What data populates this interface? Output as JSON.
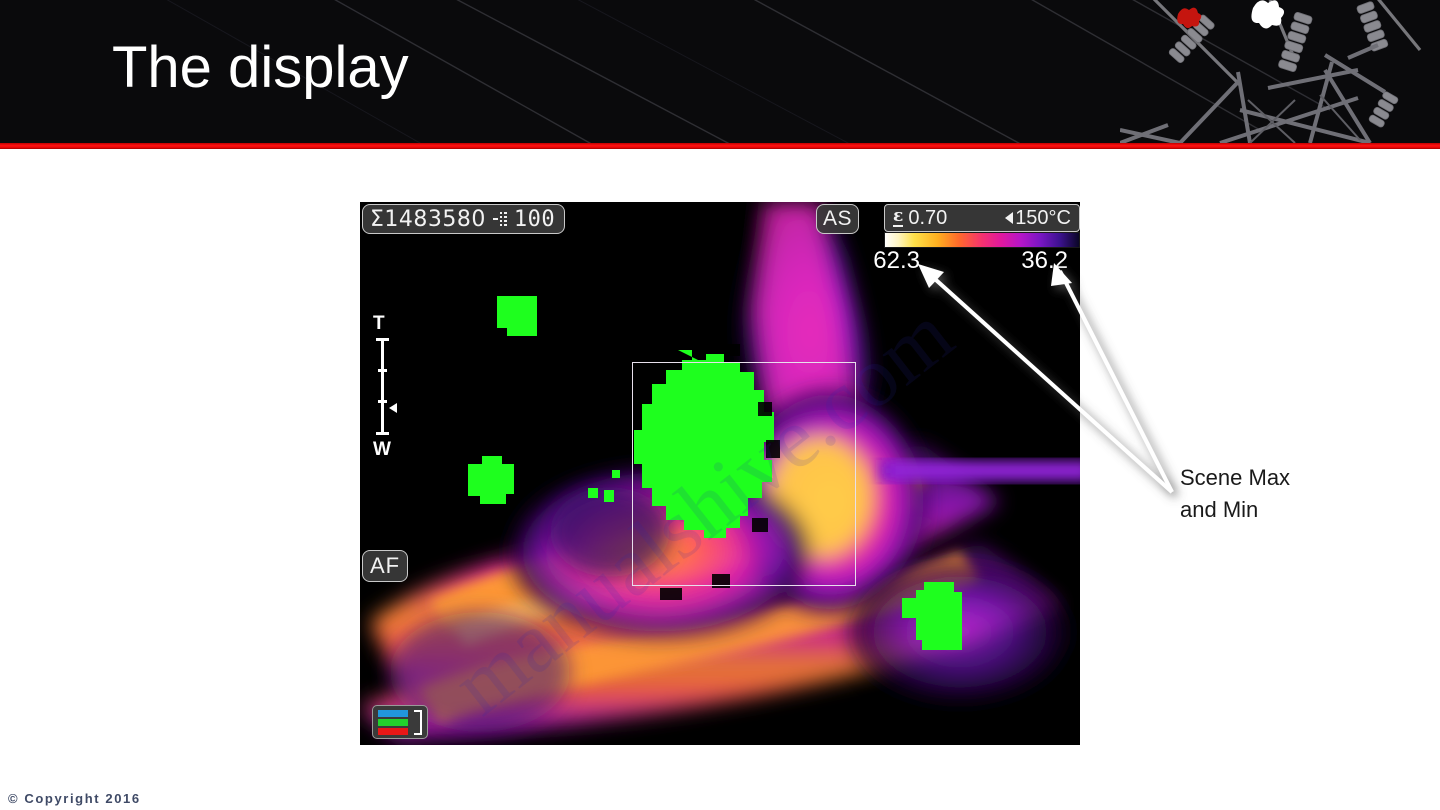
{
  "slide": {
    "title": "The display",
    "copyright": "© Copyright 2016",
    "accent_color": "#ff1212",
    "header_bg": "#0a0a0c"
  },
  "callout": {
    "line1": "Scene Max",
    "line2": "and Min"
  },
  "camera": {
    "osd": {
      "counter_sigma": "Σ1483580",
      "counter_storage": "100",
      "af_label": "AF",
      "auto_scale_label": "AS",
      "emissivity_symbol": "ε",
      "emissivity_value": "0.70",
      "range_value": "150°C",
      "range_arrow": "left-triangle"
    },
    "scale": {
      "scene_max": "62.3",
      "scene_min": "36.2",
      "palette": "ironbow-inverted"
    },
    "zoom": {
      "top_label": "T",
      "bottom_label": "W"
    },
    "battery": {
      "segments": [
        "#2196dd",
        "#22d12c",
        "#e81717"
      ]
    }
  }
}
